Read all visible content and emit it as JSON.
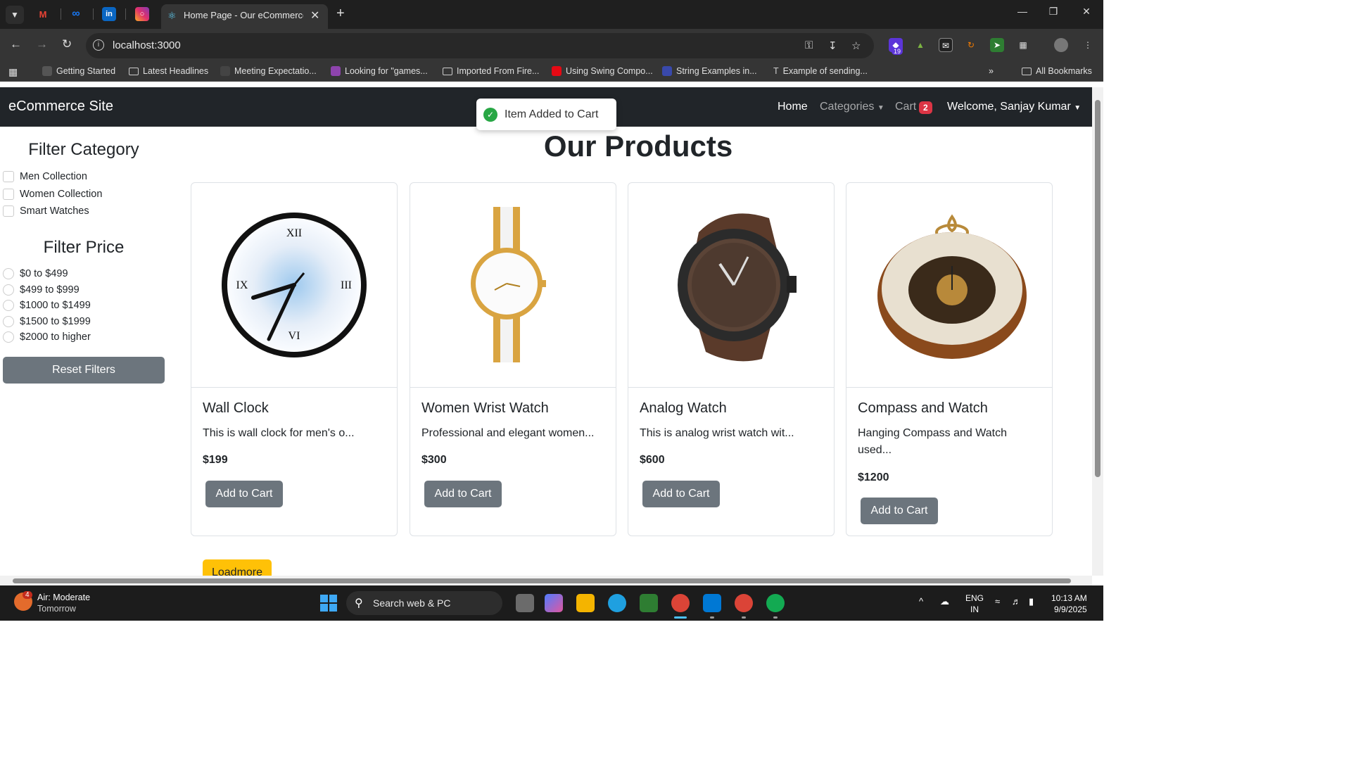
{
  "browser": {
    "tab_title": "Home Page - Our eCommerce Site",
    "url": "localhost:3000",
    "extension_badge": "19",
    "bookmarks": [
      "Getting Started",
      "Latest Headlines",
      "Meeting Expectatio...",
      "Looking for \"games...",
      "Imported From Fire...",
      "Using Swing Compo...",
      "String Examples in...",
      "Example of sending..."
    ],
    "all_bookmarks": "All Bookmarks"
  },
  "navbar": {
    "brand": "eCommerce Site",
    "home": "Home",
    "categories": "Categories",
    "cart": "Cart",
    "cart_count": "2",
    "user": "Welcome, Sanjay Kumar"
  },
  "toast": {
    "message": "Item Added to Cart"
  },
  "sidebar": {
    "category_title": "Filter Category",
    "categories": [
      "Men Collection",
      "Women Collection",
      "Smart Watches"
    ],
    "price_title": "Filter Price",
    "prices": [
      "$0 to $499",
      "$499 to $999",
      "$1000 to $1499",
      "$1500 to $1999",
      "$2000 to higher"
    ],
    "reset": "Reset Filters"
  },
  "main": {
    "title": "Our Products",
    "add_to_cart": "Add to Cart",
    "loadmore": "Loadmore",
    "products": [
      {
        "name": "Wall Clock",
        "desc": "This is wall clock for men's o...",
        "price": "$199"
      },
      {
        "name": "Women Wrist Watch",
        "desc": "Professional and elegant women...",
        "price": "$300"
      },
      {
        "name": "Analog Watch",
        "desc": "This is analog wrist watch wit...",
        "price": "$600"
      },
      {
        "name": "Compass and Watch",
        "desc": "Hanging Compass and Watch used...",
        "price": "$1200"
      }
    ]
  },
  "taskbar": {
    "weather_badge": "4",
    "weather_title": "Air: Moderate",
    "weather_sub": "Tomorrow",
    "search_placeholder": "Search web & PC",
    "lang_1": "ENG",
    "lang_2": "IN",
    "time": "10:13 AM",
    "date": "9/9/2025"
  },
  "colors": {
    "navbar_bg": "#212529",
    "button_secondary": "#6c757d",
    "loadmore": "#ffc107",
    "badge": "#dc3545",
    "toast_check": "#28a745"
  }
}
